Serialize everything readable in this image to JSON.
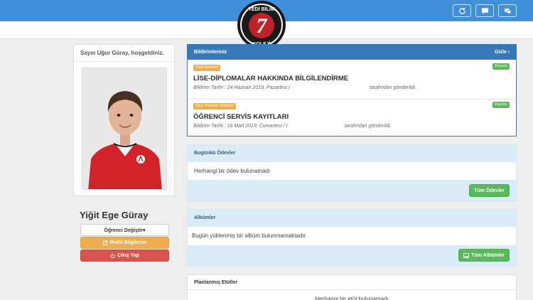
{
  "header": {
    "logo_top_text": "YEDİ BİLİM",
    "logo_numeral": "7",
    "logo_bottom_text": "KOLEJİ",
    "buttons": [
      {
        "icon": "refresh-icon"
      },
      {
        "icon": "message-icon"
      },
      {
        "icon": "chat-icon"
      }
    ]
  },
  "user": {
    "greeting": "Sayın Uğur Güray, hoşgeldiniz.",
    "student_name": "Yiğit Ege Güray",
    "switch_label": "Öğrenci Değiştir▾",
    "profile_label": "Profil Bilgilerim",
    "logout_label": "Çıkış Yap"
  },
  "notifications": {
    "title": "Bildirimleriniz",
    "hide_label": "Gizle ›",
    "items": [
      {
        "tag": "Sınıf Bildirimi",
        "badge": "Duyuru",
        "title": "LİSE-DİPLOMALAR HAKKINDA BİLGİLENDİRME",
        "meta": "Bildirim Tarihi : 24 Haziran 2019, Pazartesi /",
        "sender": "tarafından gönderildi."
      },
      {
        "tag": "Okul Yönetim Bildirimi",
        "badge": "Duyuru",
        "title": "ÖĞRENCİ SERVİS KAYITLARI",
        "meta": "Bildirim Tarihi : 16 Mart 2019, Cumartesi / I",
        "sender": "tarafından gönderildi."
      }
    ]
  },
  "homework": {
    "title": "Bugünkü Ödevler",
    "empty_text": "Herhangi bir ödev bulunamadı",
    "button_label": "Tüm Ödevler"
  },
  "albums": {
    "title": "Albümler",
    "empty_text": "Bugün yüklenmiş bir albüm bulunmamaktadır.",
    "button_label": "Tüm Albümler"
  },
  "studies": {
    "title": "Planlanmış Etütler",
    "empty_text": "Herhangi bir etüt bulunamadı"
  },
  "colors": {
    "primary": "#3f8fdb",
    "panel_header": "#d9ecf7",
    "success": "#5cb85c",
    "warning": "#f0ad4e",
    "danger": "#d9534f",
    "logo_red": "#c0212b"
  }
}
